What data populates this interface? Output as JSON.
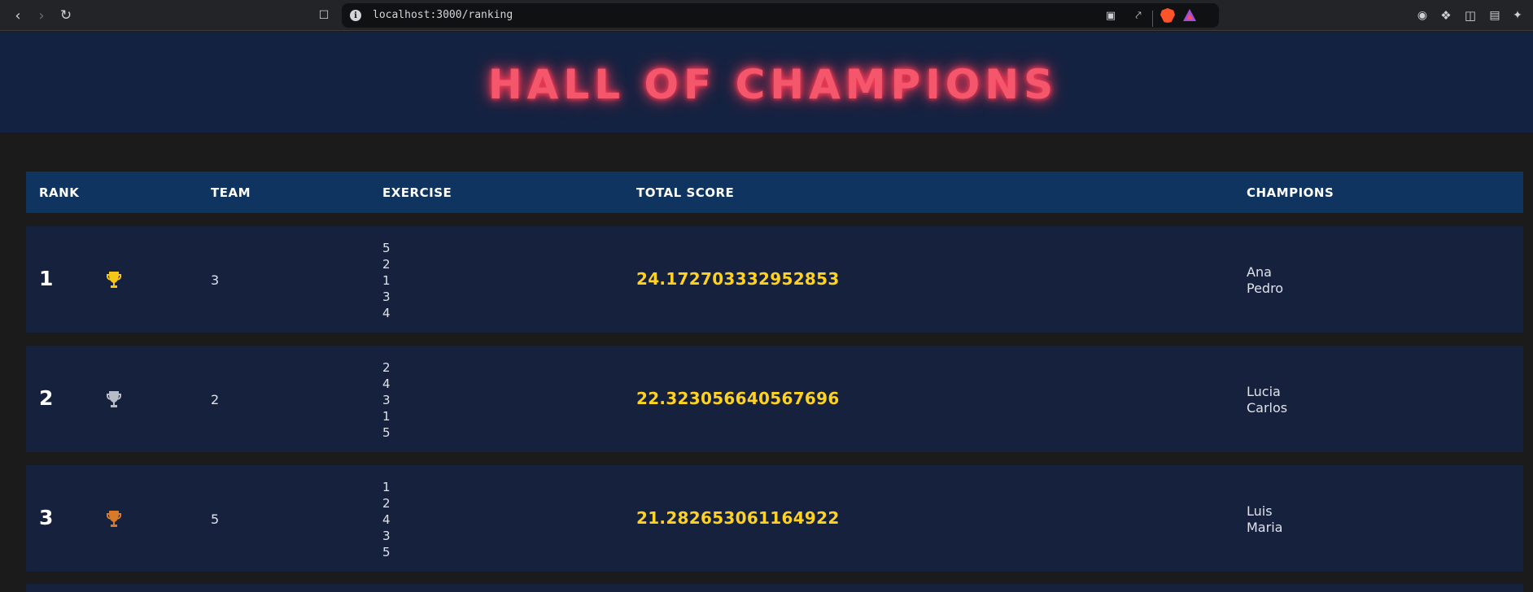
{
  "browser": {
    "url": "localhost:3000/ranking",
    "icons": {
      "back": "chevron-left-icon",
      "forward": "chevron-right-icon",
      "reload": "reload-icon",
      "bookmark": "bookmark-icon",
      "info": "info-icon",
      "cast": "cast-icon",
      "share": "share-icon",
      "brave": "brave-shield-icon",
      "rewards": "brave-rewards-icon",
      "extensions": "puzzle-icon",
      "sidebar": "sidebar-icon",
      "wallet": "wallet-icon",
      "leo": "leo-ai-icon"
    }
  },
  "page": {
    "title": "HALL OF CHAMPIONS",
    "title_color": "#f4566c"
  },
  "table": {
    "headers": {
      "rank": "RANK",
      "team": "TEAM",
      "exercise": "EXERCISE",
      "total_score": "TOTAL SCORE",
      "champions": "CHAMPIONS"
    },
    "rows": [
      {
        "rank": "1",
        "trophy": "gold",
        "trophy_color": "#f5c518",
        "team": "3",
        "exercises": [
          "5",
          "2",
          "1",
          "3",
          "4"
        ],
        "score": "24.172703332952853",
        "champions": [
          "Ana",
          "Pedro"
        ]
      },
      {
        "rank": "2",
        "trophy": "silver",
        "trophy_color": "#b8bcc6",
        "team": "2",
        "exercises": [
          "2",
          "4",
          "3",
          "1",
          "5"
        ],
        "score": "22.323056640567696",
        "champions": [
          "Lucia",
          "Carlos"
        ]
      },
      {
        "rank": "3",
        "trophy": "bronze",
        "trophy_color": "#d77a2a",
        "team": "5",
        "exercises": [
          "1",
          "2",
          "4",
          "3",
          "5"
        ],
        "score": "21.282653061164922",
        "champions": [
          "Luis",
          "Maria"
        ]
      }
    ]
  },
  "colors": {
    "background": "#1b1b1c",
    "header_band": "#142241",
    "table_header": "#0f3460",
    "row": "#16213e",
    "score": "#ffd21f"
  }
}
